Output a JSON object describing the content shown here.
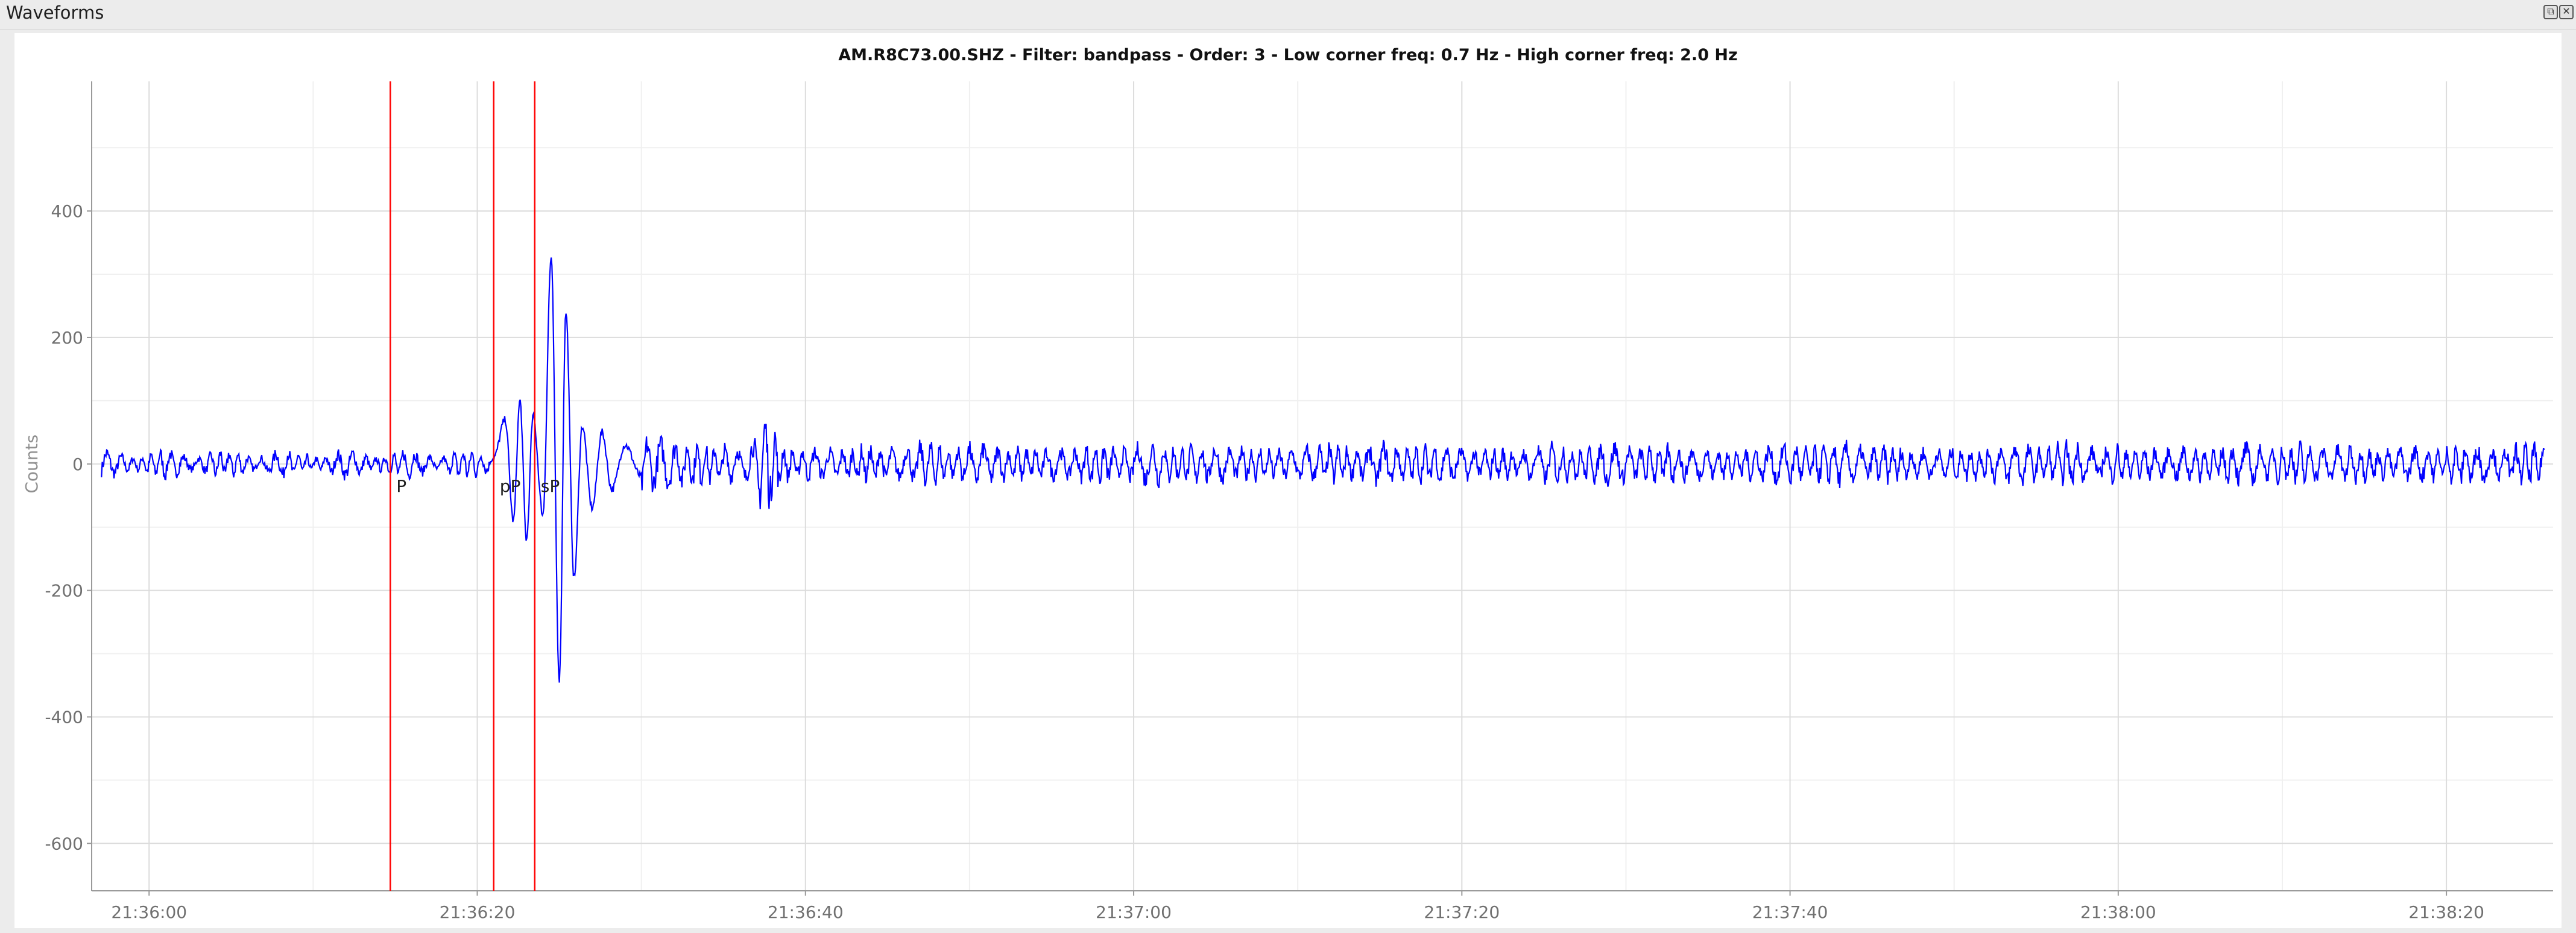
{
  "window": {
    "title": "Waveforms",
    "float_icon": "float-icon",
    "close_icon": "close-icon"
  },
  "chart_data": {
    "type": "line",
    "title": "AM.R8C73.00.SHZ - Filter: bandpass - Order: 3 - Low corner freq: 0.7 Hz - High corner freq: 2.0 Hz",
    "xlabel": "",
    "ylabel": "Counts",
    "x_ticks": [
      "21:36:00",
      "21:36:20",
      "21:36:40",
      "21:37:00",
      "21:37:20",
      "21:37:40",
      "21:38:00",
      "21:38:20"
    ],
    "y_ticks": [
      400,
      200,
      0,
      -200,
      -400,
      -600
    ],
    "xlim_seconds_after_21_36_00": [
      -3.5,
      146.5
    ],
    "ylim": [
      -675,
      605
    ],
    "grid": true,
    "line_color": "#0000ff",
    "pick_color": "#ff0000",
    "picks": [
      {
        "label": "P",
        "time": "21:36:14.7"
      },
      {
        "label": "pP",
        "time": "21:36:21.0"
      },
      {
        "label": "sP",
        "time": "21:36:23.5"
      }
    ],
    "series": [
      {
        "values_time_offset_seconds": [
          0,
          14.7,
          21.0,
          21.7,
          22.2,
          22.6,
          23.0,
          23.4,
          24.0,
          24.5,
          25.0,
          25.4,
          25.9,
          26.4,
          27.0,
          27.6,
          28.2,
          29.0,
          30.0,
          37.6,
          40.0,
          60.0,
          80.0,
          100.0,
          120.0,
          140.0,
          146.0
        ],
        "values_counts": [
          0,
          5,
          10,
          70,
          -90,
          100,
          -120,
          75,
          -80,
          325,
          -340,
          240,
          -180,
          60,
          -70,
          50,
          -40,
          30,
          -20,
          85,
          25,
          30,
          35,
          30,
          35,
          35,
          20
        ],
        "description_free": true
      }
    ]
  }
}
